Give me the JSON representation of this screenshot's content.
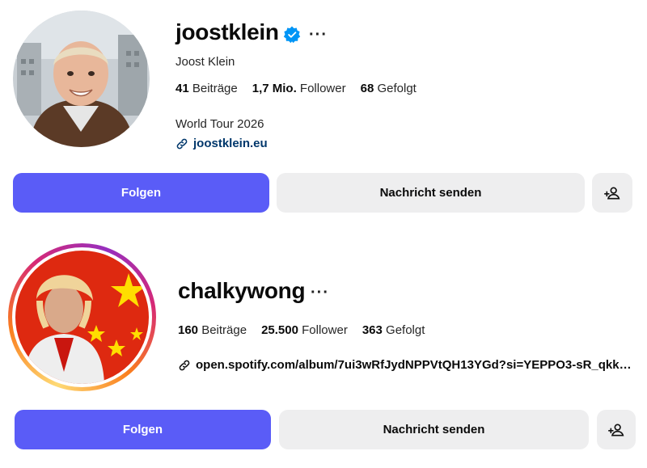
{
  "profiles": [
    {
      "username": "joostklein",
      "verified": true,
      "fullname": "Joost Klein",
      "stats": {
        "posts_count": "41",
        "posts_label": "Beiträge",
        "followers_count": "1,7 Mio.",
        "followers_label": "Follower",
        "following_count": "68",
        "following_label": "Gefolgt"
      },
      "bio": "World Tour 2026",
      "link": "joostklein.eu",
      "buttons": {
        "follow": "Folgen",
        "message": "Nachricht senden"
      }
    },
    {
      "username": "chalkywong",
      "verified": false,
      "has_story_ring": true,
      "stats": {
        "posts_count": "160",
        "posts_label": "Beiträge",
        "followers_count": "25.500",
        "followers_label": "Follower",
        "following_count": "363",
        "following_label": "Gefolgt"
      },
      "link": "open.spotify.com/album/7ui3wRfJydNPPVtQH13YGd?si=YEPPO3-sR_qkkh...",
      "buttons": {
        "follow": "Folgen",
        "message": "Nachricht senden"
      }
    }
  ],
  "colors": {
    "follow_button": "#5a5cf7",
    "secondary_button": "#eeeeef",
    "verified_badge": "#0095f6",
    "link_blue": "#00376b"
  },
  "icons": {
    "verified": "verified-badge-icon",
    "more": "more-options-icon",
    "link": "link-icon",
    "add_person": "add-person-icon"
  }
}
